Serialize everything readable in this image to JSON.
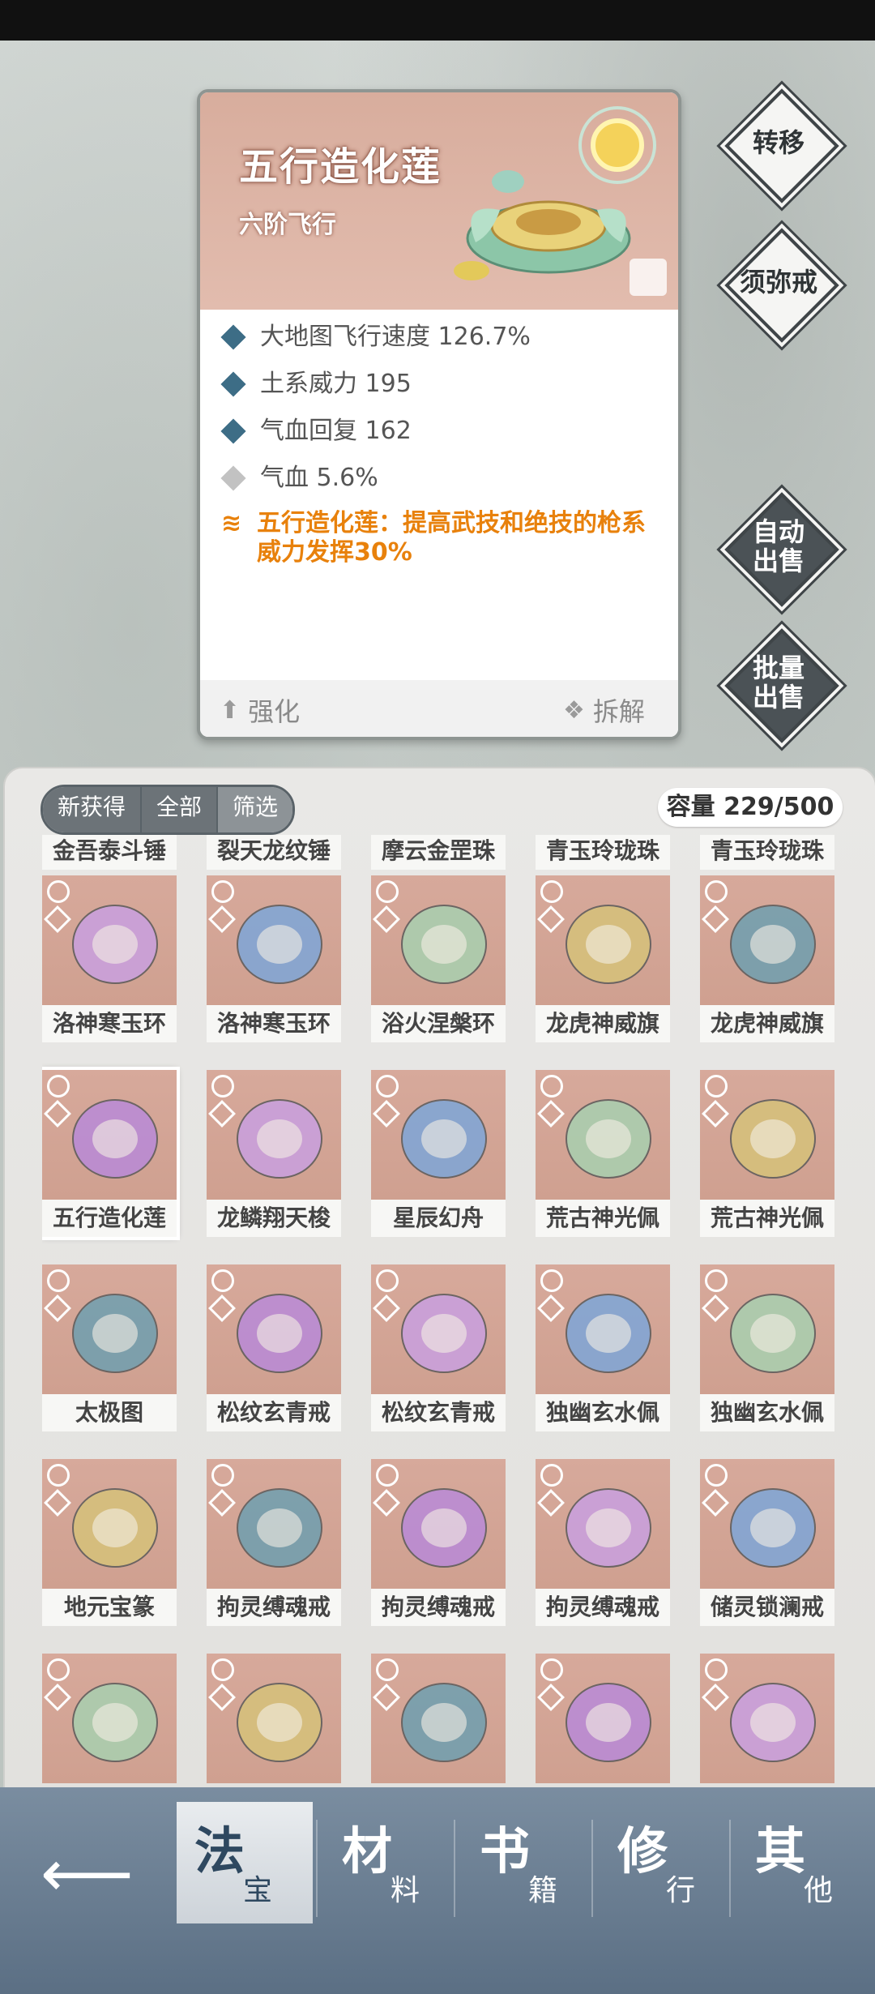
{
  "item_detail": {
    "title": "五行造化莲",
    "subtitle": "六阶飞行",
    "stats": [
      {
        "text": "大地图飞行速度 126.7%"
      },
      {
        "text": "土系威力 195"
      },
      {
        "text": "气血回复 162"
      },
      {
        "text": "气血 5.6%"
      }
    ],
    "special": "五行造化莲：提高武技和绝技的枪系威力发挥30%",
    "enhance_label": "强化",
    "dismantle_label": "拆解"
  },
  "side_buttons": {
    "transfer": "转移",
    "ring": "须弥戒",
    "auto_sell": "自动出售",
    "batch_sell": "批量出售"
  },
  "inventory": {
    "filters": [
      "新获得",
      "全部",
      "筛选"
    ],
    "capacity": "容量 229/500",
    "rows": [
      [
        "金吾泰斗锤",
        "裂天龙纹锤",
        "摩云金罡珠",
        "青玉玲珑珠",
        "青玉玲珑珠"
      ],
      [
        "洛神寒玉环",
        "洛神寒玉环",
        "浴火涅槃环",
        "龙虎神威旗",
        "龙虎神威旗"
      ],
      [
        "五行造化莲",
        "龙鳞翔天梭",
        "星辰幻舟",
        "荒古神光佩",
        "荒古神光佩"
      ],
      [
        "太极图",
        "松纹玄青戒",
        "松纹玄青戒",
        "独幽玄水佩",
        "独幽玄水佩"
      ],
      [
        "地元宝篆",
        "拘灵缚魂戒",
        "拘灵缚魂戒",
        "拘灵缚魂戒",
        "储灵锁澜戒"
      ],
      [
        "",
        "",
        "",
        "",
        ""
      ]
    ]
  },
  "nav": {
    "tabs": [
      {
        "big": "法",
        "small": "宝"
      },
      {
        "big": "材",
        "small": "料"
      },
      {
        "big": "书",
        "small": "籍"
      },
      {
        "big": "修",
        "small": "行"
      },
      {
        "big": "其",
        "small": "他"
      }
    ]
  }
}
